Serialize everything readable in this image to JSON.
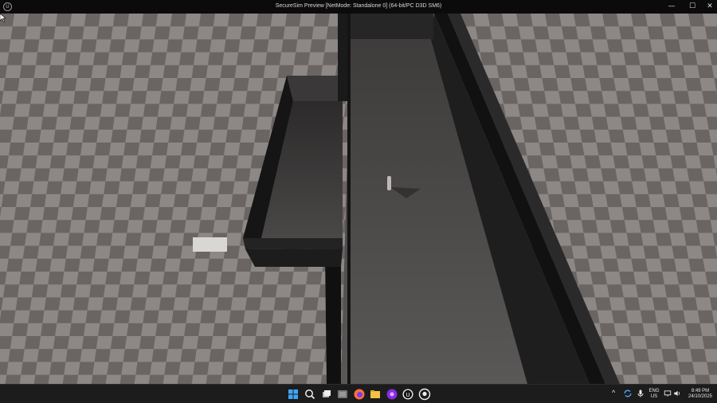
{
  "window": {
    "title": "SecureSim Preview [NetMode: Standalone 0]  (64-bit/PC D3D SM6)",
    "logo_letter": "U",
    "minimize_glyph": "—",
    "maximize_glyph": "☐",
    "close_glyph": "✕"
  },
  "viewport": {
    "scene": "3d-level-preview",
    "floor_color_light": "#8d8785",
    "floor_color_dark": "#6a6462",
    "wall_color": "#1b1b1b",
    "corridor_floor_color": "#535151"
  },
  "taskbar": {
    "icons": [
      {
        "name": "windows-start-icon"
      },
      {
        "name": "search-icon"
      },
      {
        "name": "task-view-icon"
      },
      {
        "name": "app-window-icon"
      },
      {
        "name": "firefox-icon"
      },
      {
        "name": "file-explorer-icon"
      },
      {
        "name": "purple-app-icon"
      },
      {
        "name": "unreal-engine-icon"
      },
      {
        "name": "github-icon"
      }
    ],
    "tray": {
      "chevron": "^",
      "lang_line1": "ENG",
      "lang_line2": "US",
      "time": "8:49 PM",
      "date": "24/10/2025"
    }
  }
}
